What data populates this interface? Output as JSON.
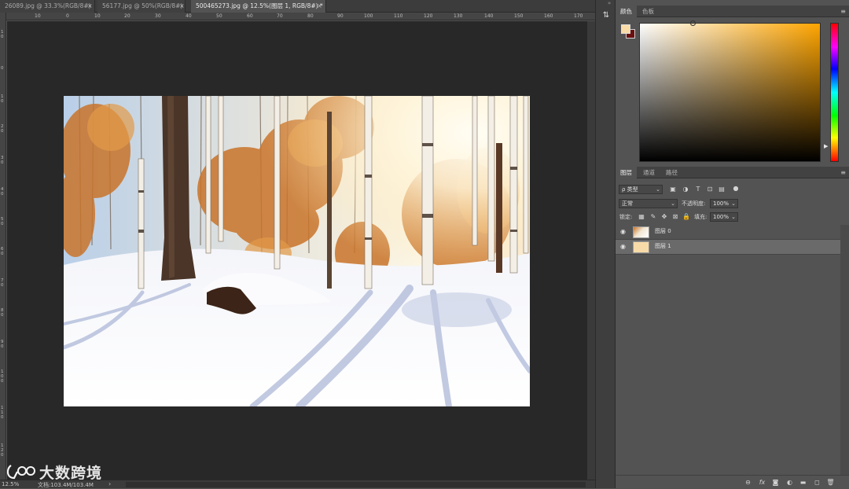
{
  "tabs": [
    {
      "label": "26089.jpg @ 33.3%(RGB/8#)",
      "close": "×"
    },
    {
      "label": "56177.jpg @ 50%(RGB/8#)",
      "close": "×"
    },
    {
      "label": "500465273.jpg @ 12.5%(图层 1, RGB/8#) *",
      "close": "×"
    }
  ],
  "ruler_top": [
    "10",
    "0",
    "10",
    "20",
    "30",
    "40",
    "50",
    "60",
    "70",
    "80",
    "90",
    "100",
    "110",
    "120",
    "130",
    "140",
    "150",
    "160",
    "170"
  ],
  "ruler_left": [
    "1 0",
    "0",
    "1 0",
    "2 0",
    "3 0",
    "4 0",
    "5 0",
    "6 0",
    "7 0",
    "8 0",
    "9 0",
    "1 0 0",
    "1 1 0",
    "1 2 0"
  ],
  "status": {
    "zoom": "12.5%",
    "doc": "文档:103.4M/103.4M",
    "arrow": "›"
  },
  "watermark": {
    "text": "大数跨境"
  },
  "panels": {
    "color_tabs": [
      "颜色",
      "色板"
    ],
    "menu": "≡",
    "layers_tabs": [
      "图层",
      "通道",
      "路径"
    ],
    "filter_label": "ρ 类型",
    "blend_mode": "正常",
    "opacity_label": "不透明度:",
    "opacity_value": "100%",
    "lock_label": "锁定:",
    "fill_label": "填充:",
    "fill_value": "100%",
    "layers": [
      {
        "name": "图层 0",
        "eye": "👁"
      },
      {
        "name": "图层 1",
        "eye": "👁"
      }
    ]
  },
  "colors": {
    "foreground": "#f8dba8",
    "background": "#6a1010",
    "hue": "#ffa500"
  },
  "icons": {
    "dropdown_arrow": "⌄",
    "footer": [
      "link-icon",
      "fx-icon",
      "mask-icon",
      "adjustment-icon",
      "folder-icon",
      "new-layer-icon",
      "trash-icon"
    ]
  },
  "footer_glyphs": [
    "⊖",
    "fx",
    "◙",
    "◐",
    "▬",
    "◻",
    "🗑"
  ],
  "tool_glyph": "⇅"
}
